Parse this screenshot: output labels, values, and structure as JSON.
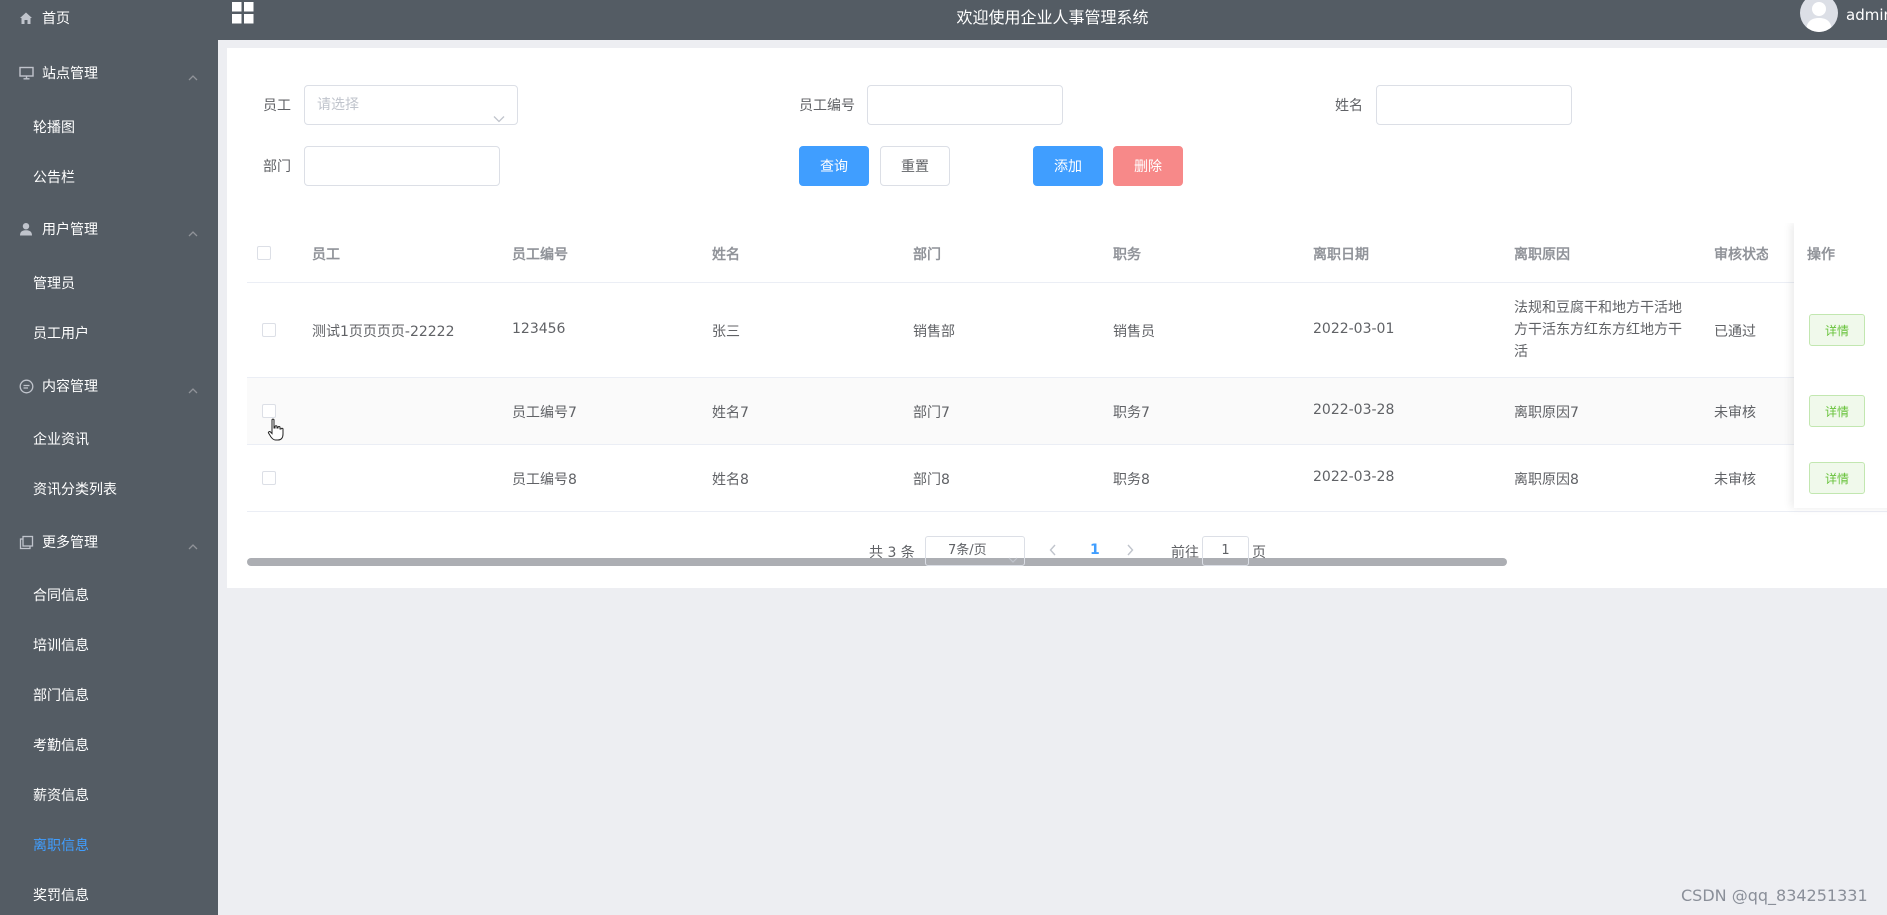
{
  "sidebar": {
    "items": [
      {
        "label": "首页",
        "icon": "home-icon"
      },
      {
        "label": "站点管理",
        "icon": "monitor-icon"
      },
      {
        "label": "轮播图"
      },
      {
        "label": "公告栏"
      },
      {
        "label": "用户管理",
        "icon": "user-icon"
      },
      {
        "label": "管理员"
      },
      {
        "label": "员工用户"
      },
      {
        "label": "内容管理",
        "icon": "chat-icon"
      },
      {
        "label": "企业资讯"
      },
      {
        "label": "资讯分类列表"
      },
      {
        "label": "更多管理",
        "icon": "copy-icon"
      },
      {
        "label": "合同信息"
      },
      {
        "label": "培训信息"
      },
      {
        "label": "部门信息"
      },
      {
        "label": "考勤信息"
      },
      {
        "label": "薪资信息"
      },
      {
        "label": "离职信息"
      },
      {
        "label": "奖罚信息"
      }
    ],
    "active_color": "#409eff"
  },
  "header": {
    "title": "欢迎使用企业人事管理系统",
    "user": "admin"
  },
  "filters": {
    "employee_label": "员工",
    "employee_placeholder": "请选择",
    "code_label": "员工编号",
    "name_label": "姓名",
    "dept_label": "部门"
  },
  "buttons": {
    "search": "查询",
    "reset": "重置",
    "add": "添加",
    "delete": "删除"
  },
  "table": {
    "columns": [
      "员工",
      "员工编号",
      "姓名",
      "部门",
      "职务",
      "离职日期",
      "离职原因",
      "审核状态",
      "操作"
    ],
    "rows": [
      {
        "employee": "测试1页页页页-22222",
        "code": "123456",
        "name": "张三",
        "dept": "销售部",
        "position": "销售员",
        "date": "2022-03-01",
        "reason": "法规和豆腐干和地方干活地方干活东方红东方红地方干活",
        "status": "已通过",
        "action": "详情"
      },
      {
        "employee": "",
        "code": "员工编号7",
        "name": "姓名7",
        "dept": "部门7",
        "position": "职务7",
        "date": "2022-03-28",
        "reason": "离职原因7",
        "status": "未审核",
        "action": "详情"
      },
      {
        "employee": "",
        "code": "员工编号8",
        "name": "姓名8",
        "dept": "部门8",
        "position": "职务8",
        "date": "2022-03-28",
        "reason": "离职原因8",
        "status": "未审核",
        "action": "详情"
      }
    ]
  },
  "pagination": {
    "total": "共 3 条",
    "page_size": "7条/页",
    "current_page": "1",
    "goto_label": "前往",
    "goto_value": "1",
    "page_suffix": "页"
  },
  "watermark": "CSDN @qq_834251331",
  "colors": {
    "sidebar_bg": "#545c64",
    "primary": "#409eff",
    "danger": "#f78989",
    "success": "#67c23a"
  }
}
